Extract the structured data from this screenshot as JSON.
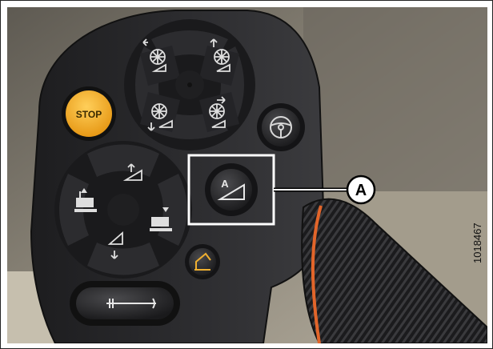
{
  "figure": {
    "number": "1018467"
  },
  "callout": {
    "letter": "A",
    "target": "auto-header-height-button"
  },
  "buttons": {
    "stop_label": "STOP",
    "auto_button_letter": "A"
  },
  "colors": {
    "stop_button": "#f4a81d",
    "handle_body": "#2b2b2d",
    "grip_accent": "#e2652a",
    "callout_box": "#ffffff",
    "callout_line": "#000000",
    "background_wall": "#8a8478"
  },
  "icons": [
    "reel-up-arrow-icon",
    "reel-forward-icon",
    "reel-down-icon",
    "reel-aft-icon",
    "header-tilt-up-icon",
    "header-tilt-down-icon",
    "header-raise-icon",
    "header-lower-icon",
    "steering-wheel-icon",
    "auto-header-icon",
    "unload-auger-icon",
    "header-float-icon"
  ]
}
